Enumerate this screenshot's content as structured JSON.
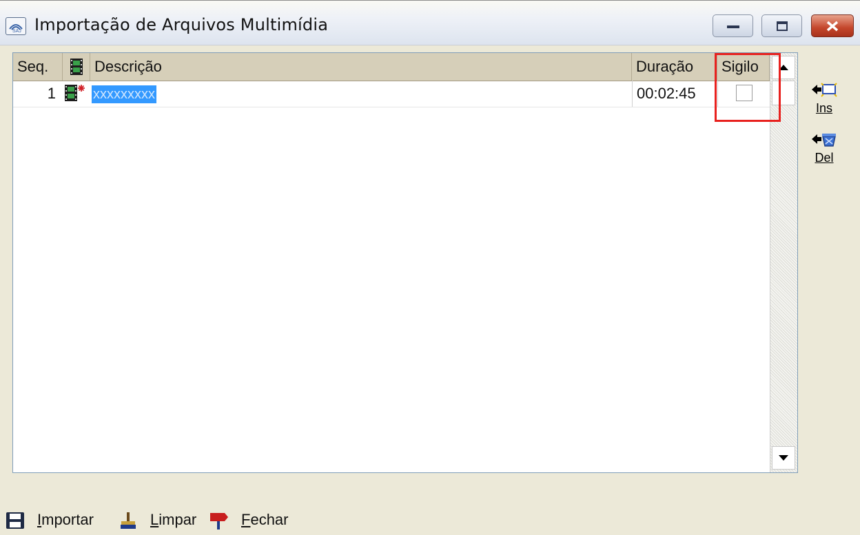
{
  "window": {
    "title": "Importação de Arquivos Multimídia",
    "colors": {
      "highlight": "#e8211e",
      "selection": "#3399ff",
      "header_bg": "#d6cfb9"
    }
  },
  "grid": {
    "columns": {
      "seq": "Seq.",
      "icon": "film-icon",
      "descricao": "Descrição",
      "duracao": "Duração",
      "sigilo": "Sigilo"
    },
    "rows": [
      {
        "seq": "1",
        "icon": "film-new-icon",
        "descricao": "xxxxxxxxx",
        "duracao": "00:02:45",
        "sigilo": false
      }
    ]
  },
  "side_buttons": {
    "insert_label": "Ins",
    "delete_label": "Del"
  },
  "toolbar": {
    "import": {
      "first": "I",
      "rest": "mportar"
    },
    "clear": {
      "first": "L",
      "rest": "impar"
    },
    "close": {
      "first": "F",
      "rest": "echar"
    }
  }
}
